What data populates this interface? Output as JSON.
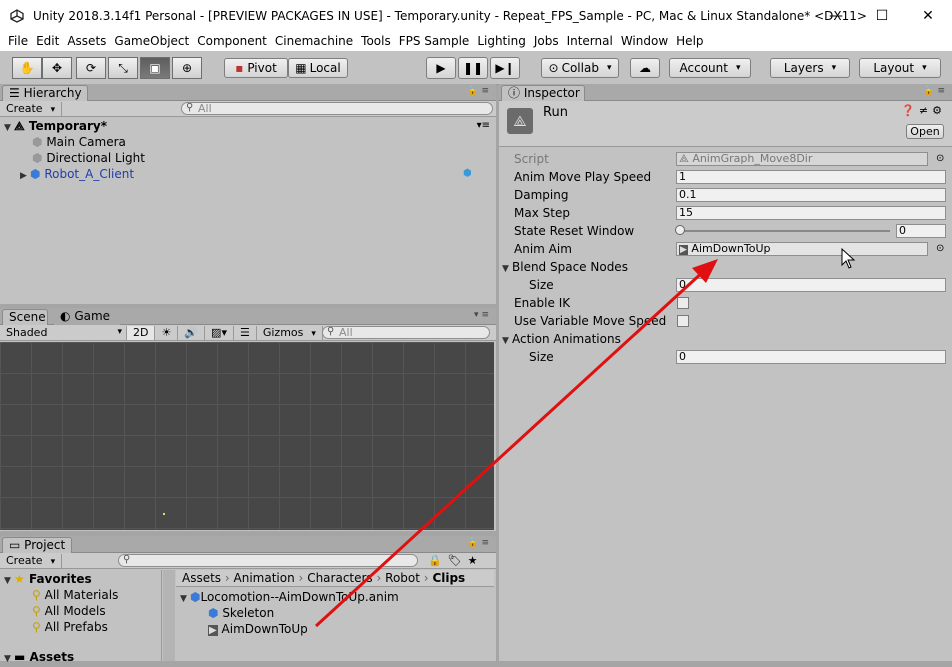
{
  "window": {
    "title": "Unity 2018.3.14f1 Personal - [PREVIEW PACKAGES IN USE] - Temporary.unity - Repeat_FPS_Sample - PC, Mac & Linux Standalone* <DX11>"
  },
  "menu": [
    "File",
    "Edit",
    "Assets",
    "GameObject",
    "Component",
    "Cinemachine",
    "Tools",
    "FPS Sample",
    "Lighting",
    "Jobs",
    "Internal",
    "Window",
    "Help"
  ],
  "toolbar": {
    "pivot": "Pivot",
    "local": "Local",
    "collab": "Collab",
    "account": "Account",
    "layers": "Layers",
    "layout": "Layout"
  },
  "hierarchy": {
    "tab": "Hierarchy",
    "create": "Create",
    "search": "All",
    "scene": "Temporary*",
    "items": [
      "Main Camera",
      "Directional Light",
      "Robot_A_Client"
    ]
  },
  "scene": {
    "tab_scene": "Scene",
    "tab_game": "Game",
    "shading": "Shaded",
    "mode2d": "2D",
    "gizmos": "Gizmos",
    "search": "All"
  },
  "inspector": {
    "tab": "Inspector",
    "object_name": "Run",
    "open_label": "Open",
    "fields": [
      {
        "label": "Script",
        "value": "AnimGraph_Move8Dir"
      },
      {
        "label": "Anim Move Play Speed",
        "value": "1"
      },
      {
        "label": "Damping",
        "value": "0.1"
      },
      {
        "label": "Max Step",
        "value": "15"
      },
      {
        "label": "State Reset Window",
        "value": "0"
      },
      {
        "label": "Anim Aim",
        "value": "AimDownToUp"
      },
      {
        "label": "Blend Space Nodes",
        "value": ""
      },
      {
        "label": "Size",
        "value": "0"
      },
      {
        "label": "Enable IK",
        "value": ""
      },
      {
        "label": "Use Variable Move Speed",
        "value": ""
      },
      {
        "label": "Action Animations",
        "value": ""
      },
      {
        "label": "Size",
        "value": "0"
      }
    ]
  },
  "project": {
    "tab": "Project",
    "create": "Create",
    "favorites": "Favorites",
    "fav_items": [
      "All Materials",
      "All Models",
      "All Prefabs"
    ],
    "assets_root": "Assets",
    "breadcrumb": [
      "Assets",
      "Animation",
      "Characters",
      "Robot",
      "Clips"
    ],
    "files": [
      "Locomotion--AimDownToUp.anim",
      "Skeleton",
      "AimDownToUp"
    ]
  },
  "colors": {
    "arrow": "#e01010",
    "link_text": "#1f3fa8"
  }
}
